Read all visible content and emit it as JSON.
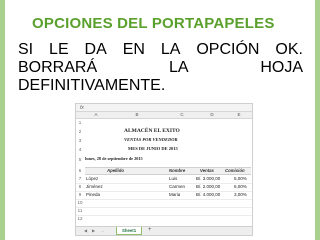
{
  "slide": {
    "title": "OPCIONES DEL PORTAPAPELES",
    "body_lines": [
      [
        "SI",
        "LE",
        "DA",
        "EN",
        "LA",
        "OPCIÓN",
        "OK."
      ],
      [
        "BORRARÁ",
        "LA",
        "HOJA"
      ],
      [
        "DEFINITIVAMENTE."
      ]
    ],
    "accent_color": "#5aa02c",
    "border_color": "#a9d08e"
  },
  "spreadsheet": {
    "corner_icon": "formula-icon",
    "columns": [
      "A",
      "B",
      "C",
      "D",
      "E"
    ],
    "rows": [
      "1",
      "2",
      "3",
      "4",
      "5",
      "6",
      "7",
      "8",
      "9",
      "10",
      "11",
      "12"
    ],
    "company": "ALMACÉN EL EXITO",
    "report_title": "VENTAS POR VENDEDOR",
    "period": "MES DE JUNIO DE 2015",
    "date": "lunes, 28 de septiembre de 2015",
    "headers": [
      "Apellido",
      "Nombre",
      "Ventas",
      "Comisión"
    ],
    "rows_data": [
      [
        "López",
        "Luis",
        "B/. 3.000,00",
        "5,00%"
      ],
      [
        "Jiménez",
        "Carmen",
        "B/. 2.000,00",
        "6,00%"
      ],
      [
        "Pineda",
        "Maria",
        "B/. 4.000,00",
        "3,00%"
      ]
    ],
    "sheet_tab": "Sheet1",
    "add_sheet": "+",
    "nav": [
      "◀",
      "▶",
      "..."
    ]
  }
}
